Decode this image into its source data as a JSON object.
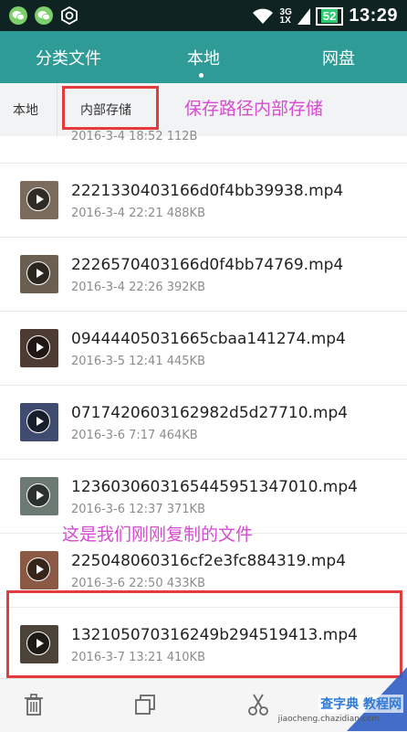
{
  "status": {
    "time": "13:29",
    "battery": "52",
    "signal_top": "3G",
    "signal_bottom": "1X"
  },
  "tabs": [
    {
      "label": "分类文件"
    },
    {
      "label": "本地"
    },
    {
      "label": "网盘"
    }
  ],
  "breadcrumb": {
    "root": "本地",
    "current": "内部存储"
  },
  "annotations": {
    "path_note": "保存路径内部存储",
    "copied_note": "这是我们刚刚复制的文件"
  },
  "partial_row": {
    "meta": "2016-3-4 18:52 112B"
  },
  "files": [
    {
      "name": "2221330403166d0f4bb39938.mp4",
      "meta": "2016-3-4 22:21 488KB",
      "thumb": "#7a6b5d"
    },
    {
      "name": "2226570403166d0f4bb74769.mp4",
      "meta": "2016-3-4 22:26 392KB",
      "thumb": "#6b5f52"
    },
    {
      "name": "09444405031665cbaa141274.mp4",
      "meta": "2016-3-5 12:41 445KB",
      "thumb": "#4e3b34"
    },
    {
      "name": "0717420603162982d5d27710.mp4",
      "meta": "2016-3-6 7:17 464KB",
      "thumb": "#3f4b6f"
    },
    {
      "name": "1236030603165445951347010.mp4",
      "meta": "2016-3-6 12:37 371KB",
      "thumb": "#6c7a73"
    },
    {
      "name": "225048060316cf2e3fc884319.mp4",
      "meta": "2016-3-6 22:50 433KB",
      "thumb": "#8a5a45"
    },
    {
      "name": "132105070316249b294519413.mp4",
      "meta": "2016-3-7 13:21 410KB",
      "thumb": "#4d4439"
    }
  ],
  "bottom_bar": {
    "icons": [
      "trash-icon",
      "copy-icon",
      "cut-icon"
    ]
  },
  "watermark": {
    "line1": "查字典 教程网",
    "line2": "jiaocheng.chazidian.com"
  }
}
